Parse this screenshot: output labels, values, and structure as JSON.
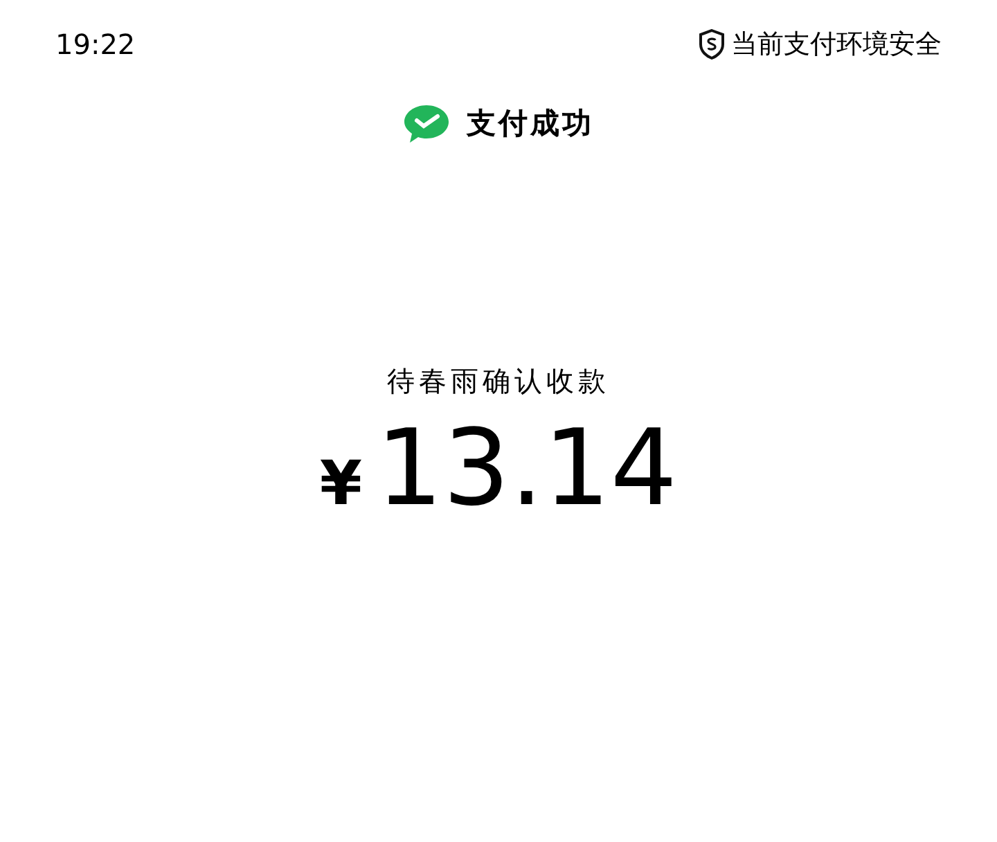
{
  "status_bar": {
    "time": "19:22",
    "security_text": "当前支付环境安全"
  },
  "header": {
    "title": "支付成功"
  },
  "payment": {
    "label": "待春雨确认收款",
    "currency": "¥",
    "amount": "13.14"
  }
}
